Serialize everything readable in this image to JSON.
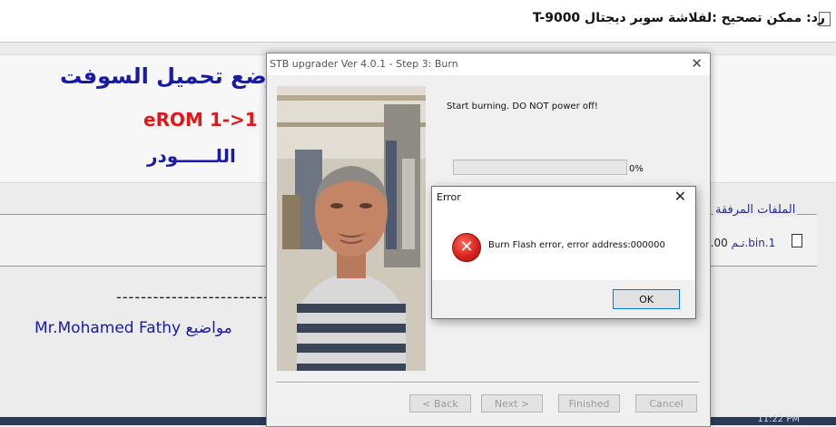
{
  "forum": {
    "post_title": "رد: ممكن تصحيح :لفلاشة سوبر ديجتال T-9000",
    "line1": "ل وضع تحميل السوفت",
    "erom": "eROM 1->1",
    "loader": "اللــــــودر",
    "attach_legend": "الملفات المرفقة",
    "attach_file_name": "تـم.bin.1",
    "attach_file_size": "(.00",
    "dashes": "--------------------------------------",
    "signature_name": "Mr.Mohamed Fathy",
    "signature_suffix": "مواضيع",
    "bottom_text": "11:22 PM"
  },
  "wizard": {
    "title": "STB upgrader Ver 4.0.1 - Step 3: Burn",
    "close_label": "✕",
    "message": "Start burning. DO NOT power off!",
    "progress_fraction": 0,
    "progress_label": "0%",
    "buttons": {
      "back": "< Back",
      "next": "Next >",
      "finished": "Finished",
      "cancel": "Cancel"
    }
  },
  "error_dialog": {
    "title": "Error",
    "close_label": "✕",
    "icon_glyph": "✕",
    "message": "Burn Flash error, error address:000000",
    "ok_label": "OK"
  },
  "colors": {
    "accent": "#0078d7",
    "progress": "#06b025",
    "error_red": "#d8231b",
    "forum_blue": "#1a1aa8",
    "forum_red": "#e01818"
  }
}
